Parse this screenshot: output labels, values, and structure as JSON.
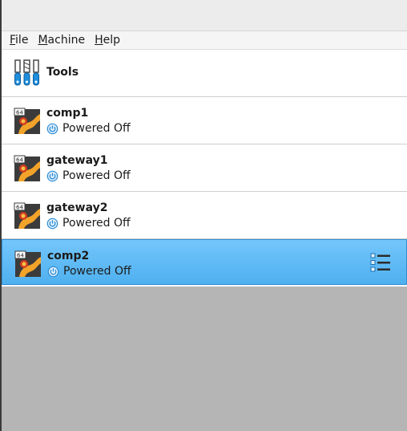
{
  "menu": {
    "items": [
      {
        "mnemonic": "F",
        "rest": "ile"
      },
      {
        "mnemonic": "M",
        "rest": "achine"
      },
      {
        "mnemonic": "H",
        "rest": "elp"
      }
    ]
  },
  "tools": {
    "label": "Tools",
    "icon": "tools-icon"
  },
  "vms": [
    {
      "name": "comp1",
      "state": "Powered Off",
      "arch_badge": "64"
    },
    {
      "name": "gateway1",
      "state": "Powered Off",
      "arch_badge": "64"
    },
    {
      "name": "gateway2",
      "state": "Powered Off",
      "arch_badge": "64"
    },
    {
      "name": "comp2",
      "state": "Powered Off",
      "arch_badge": "64",
      "selected": true
    }
  ],
  "colors": {
    "selection": "#5bb8f5",
    "power_icon": "#2a8bd6",
    "empty_area": "#b5b5b5"
  }
}
